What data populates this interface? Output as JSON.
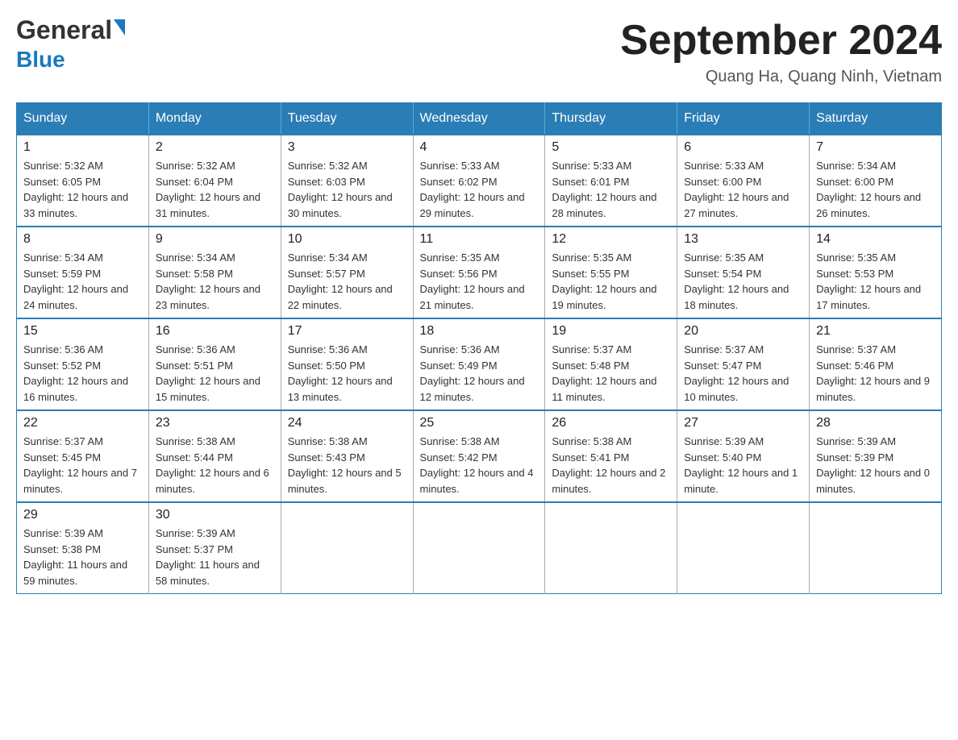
{
  "header": {
    "logo_general": "General",
    "logo_blue": "Blue",
    "title": "September 2024",
    "subtitle": "Quang Ha, Quang Ninh, Vietnam"
  },
  "calendar": {
    "days_of_week": [
      "Sunday",
      "Monday",
      "Tuesday",
      "Wednesday",
      "Thursday",
      "Friday",
      "Saturday"
    ],
    "weeks": [
      [
        {
          "day": "1",
          "sunrise": "5:32 AM",
          "sunset": "6:05 PM",
          "daylight": "12 hours and 33 minutes."
        },
        {
          "day": "2",
          "sunrise": "5:32 AM",
          "sunset": "6:04 PM",
          "daylight": "12 hours and 31 minutes."
        },
        {
          "day": "3",
          "sunrise": "5:32 AM",
          "sunset": "6:03 PM",
          "daylight": "12 hours and 30 minutes."
        },
        {
          "day": "4",
          "sunrise": "5:33 AM",
          "sunset": "6:02 PM",
          "daylight": "12 hours and 29 minutes."
        },
        {
          "day": "5",
          "sunrise": "5:33 AM",
          "sunset": "6:01 PM",
          "daylight": "12 hours and 28 minutes."
        },
        {
          "day": "6",
          "sunrise": "5:33 AM",
          "sunset": "6:00 PM",
          "daylight": "12 hours and 27 minutes."
        },
        {
          "day": "7",
          "sunrise": "5:34 AM",
          "sunset": "6:00 PM",
          "daylight": "12 hours and 26 minutes."
        }
      ],
      [
        {
          "day": "8",
          "sunrise": "5:34 AM",
          "sunset": "5:59 PM",
          "daylight": "12 hours and 24 minutes."
        },
        {
          "day": "9",
          "sunrise": "5:34 AM",
          "sunset": "5:58 PM",
          "daylight": "12 hours and 23 minutes."
        },
        {
          "day": "10",
          "sunrise": "5:34 AM",
          "sunset": "5:57 PM",
          "daylight": "12 hours and 22 minutes."
        },
        {
          "day": "11",
          "sunrise": "5:35 AM",
          "sunset": "5:56 PM",
          "daylight": "12 hours and 21 minutes."
        },
        {
          "day": "12",
          "sunrise": "5:35 AM",
          "sunset": "5:55 PM",
          "daylight": "12 hours and 19 minutes."
        },
        {
          "day": "13",
          "sunrise": "5:35 AM",
          "sunset": "5:54 PM",
          "daylight": "12 hours and 18 minutes."
        },
        {
          "day": "14",
          "sunrise": "5:35 AM",
          "sunset": "5:53 PM",
          "daylight": "12 hours and 17 minutes."
        }
      ],
      [
        {
          "day": "15",
          "sunrise": "5:36 AM",
          "sunset": "5:52 PM",
          "daylight": "12 hours and 16 minutes."
        },
        {
          "day": "16",
          "sunrise": "5:36 AM",
          "sunset": "5:51 PM",
          "daylight": "12 hours and 15 minutes."
        },
        {
          "day": "17",
          "sunrise": "5:36 AM",
          "sunset": "5:50 PM",
          "daylight": "12 hours and 13 minutes."
        },
        {
          "day": "18",
          "sunrise": "5:36 AM",
          "sunset": "5:49 PM",
          "daylight": "12 hours and 12 minutes."
        },
        {
          "day": "19",
          "sunrise": "5:37 AM",
          "sunset": "5:48 PM",
          "daylight": "12 hours and 11 minutes."
        },
        {
          "day": "20",
          "sunrise": "5:37 AM",
          "sunset": "5:47 PM",
          "daylight": "12 hours and 10 minutes."
        },
        {
          "day": "21",
          "sunrise": "5:37 AM",
          "sunset": "5:46 PM",
          "daylight": "12 hours and 9 minutes."
        }
      ],
      [
        {
          "day": "22",
          "sunrise": "5:37 AM",
          "sunset": "5:45 PM",
          "daylight": "12 hours and 7 minutes."
        },
        {
          "day": "23",
          "sunrise": "5:38 AM",
          "sunset": "5:44 PM",
          "daylight": "12 hours and 6 minutes."
        },
        {
          "day": "24",
          "sunrise": "5:38 AM",
          "sunset": "5:43 PM",
          "daylight": "12 hours and 5 minutes."
        },
        {
          "day": "25",
          "sunrise": "5:38 AM",
          "sunset": "5:42 PM",
          "daylight": "12 hours and 4 minutes."
        },
        {
          "day": "26",
          "sunrise": "5:38 AM",
          "sunset": "5:41 PM",
          "daylight": "12 hours and 2 minutes."
        },
        {
          "day": "27",
          "sunrise": "5:39 AM",
          "sunset": "5:40 PM",
          "daylight": "12 hours and 1 minute."
        },
        {
          "day": "28",
          "sunrise": "5:39 AM",
          "sunset": "5:39 PM",
          "daylight": "12 hours and 0 minutes."
        }
      ],
      [
        {
          "day": "29",
          "sunrise": "5:39 AM",
          "sunset": "5:38 PM",
          "daylight": "11 hours and 59 minutes."
        },
        {
          "day": "30",
          "sunrise": "5:39 AM",
          "sunset": "5:37 PM",
          "daylight": "11 hours and 58 minutes."
        },
        null,
        null,
        null,
        null,
        null
      ]
    ],
    "labels": {
      "sunrise": "Sunrise: ",
      "sunset": "Sunset: ",
      "daylight": "Daylight: "
    }
  }
}
